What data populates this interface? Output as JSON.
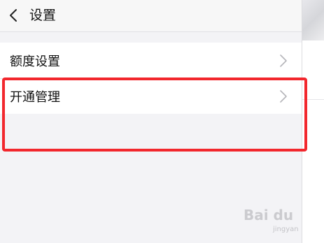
{
  "nav": {
    "title": "设置"
  },
  "list": {
    "items": [
      {
        "label": "额度设置"
      },
      {
        "label": "开通管理"
      }
    ]
  },
  "watermark": {
    "text": "Bai du",
    "sub": "jingyan"
  },
  "colors": {
    "highlight": "#f2272d",
    "background": "#f3f3f6",
    "row": "#ffffff"
  }
}
